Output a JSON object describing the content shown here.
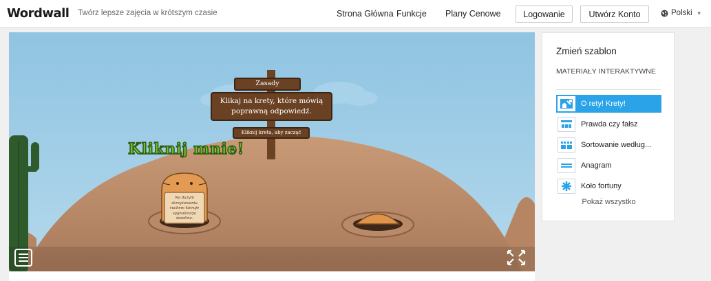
{
  "header": {
    "logo": "Wordwall",
    "tagline": "Twórz lepsze zajęcia w krótszym czasie",
    "nav": [
      "Strona Główna",
      "Funkcje",
      "Plany Cenowe"
    ],
    "login": "Logowanie",
    "signup": "Utwórz Konto",
    "language": "Polski"
  },
  "game": {
    "sign_title": "Zasady",
    "sign_main_1": "Klikaj na krety, które mówią",
    "sign_main_2": "poprawną odpowiedź.",
    "sign_sub": "Kliknij kreta, aby zacząć",
    "click_me": "Kliknij mnie!",
    "mole_text": [
      "Na dużym",
      "skrzyżowaniu",
      "ruchem kieruje",
      "sygnalizacja",
      "świetlna."
    ]
  },
  "sidebar": {
    "title": "Zmień szablon",
    "section": "MATERIAŁY INTERAKTYWNE",
    "templates": [
      {
        "label": "O rety! Krety!",
        "icon": "whack-a-mole-icon",
        "selected": true
      },
      {
        "label": "Prawda czy fałsz",
        "icon": "true-false-icon",
        "selected": false
      },
      {
        "label": "Sortowanie według...",
        "icon": "group-sort-icon",
        "selected": false
      },
      {
        "label": "Anagram",
        "icon": "anagram-icon",
        "selected": false
      },
      {
        "label": "Koło fortuny",
        "icon": "wheel-icon",
        "selected": false
      }
    ],
    "show_all": "Pokaż wszystko"
  },
  "colors": {
    "accent": "#2aa3e8",
    "sky": "#93c7e4",
    "hill": "#c89773",
    "sign": "#6b4123",
    "click_me": "#5ea82b"
  }
}
